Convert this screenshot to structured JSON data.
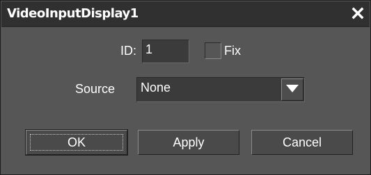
{
  "dialog": {
    "title": "VideoInputDisplay1",
    "close_icon": "close-icon"
  },
  "form": {
    "id_label": "ID:",
    "id_value": "1",
    "fix_label": "Fix",
    "fix_checked": false,
    "source_label": "Source",
    "source_value": "None",
    "source_arrow_icon": "dropdown-arrow-icon"
  },
  "buttons": {
    "ok_label": "OK",
    "apply_label": "Apply",
    "cancel_label": "Cancel"
  },
  "colors": {
    "background": "#565656",
    "titlebar": "#303030",
    "field": "#3b3b3b",
    "text": "#ffffff"
  }
}
